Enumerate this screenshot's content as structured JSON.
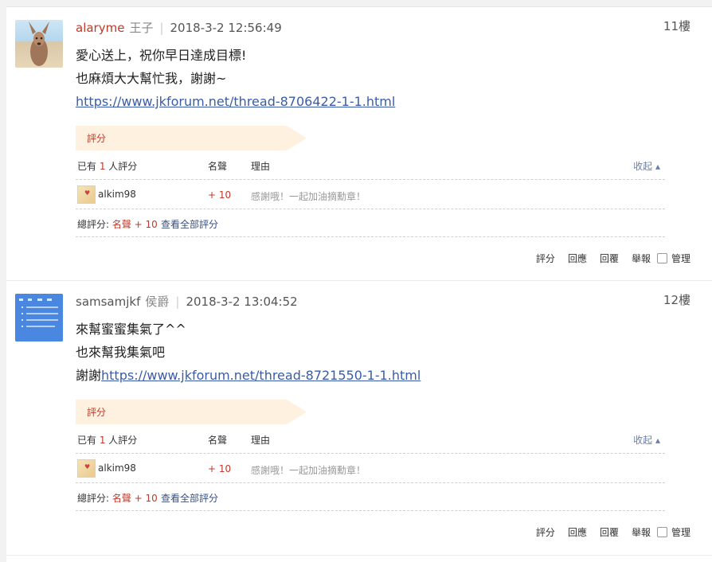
{
  "posts": [
    {
      "author": "alaryme",
      "rank": "王子",
      "time": "2018-3-2 12:56:49",
      "floor": "11樓",
      "avatar": "kangaroo-avatar",
      "lines": [
        "愛心送上，祝你早日達成目標!",
        "也麻煩大大幫忙我，謝謝~"
      ],
      "link_prefix": "",
      "link": "https://www.jkforum.net/thread-8706422-1-1.html",
      "rating": {
        "tab": "評分",
        "header_prefix": "已有 ",
        "header_count": "1",
        "header_suffix": " 人評分",
        "col_score": "名聲",
        "col_reason": "理由",
        "collapse": "收起 ▴",
        "rows": [
          {
            "user": "alkim98",
            "score": "+ 10",
            "reason": "感謝哦！一起加油摘勳章！"
          }
        ],
        "summary_label": "總評分: ",
        "summary_value": "名聲 + 10",
        "view_all": "查看全部評分"
      },
      "actions": {
        "rate": "評分",
        "reply": "回應",
        "reply2": "回覆",
        "report": "舉報",
        "manage": "管理"
      }
    },
    {
      "author": "samsamjkf",
      "rank": "侯爵",
      "time": "2018-3-2 13:04:52",
      "floor": "12樓",
      "avatar": "document-avatar",
      "lines": [
        "來幫蜜蜜集氣了^^",
        "也來幫我集氣吧"
      ],
      "link_prefix": "謝謝",
      "link": "https://www.jkforum.net/thread-8721550-1-1.html",
      "rating": {
        "tab": "評分",
        "header_prefix": "已有 ",
        "header_count": "1",
        "header_suffix": " 人評分",
        "col_score": "名聲",
        "col_reason": "理由",
        "collapse": "收起 ▴",
        "rows": [
          {
            "user": "alkim98",
            "score": "+ 10",
            "reason": "感謝哦！一起加油摘勳章！"
          }
        ],
        "summary_label": "總評分: ",
        "summary_value": "名聲 + 10",
        "view_all": "查看全部評分"
      },
      "actions": {
        "rate": "評分",
        "reply": "回應",
        "reply2": "回覆",
        "report": "舉報",
        "manage": "管理"
      }
    }
  ]
}
